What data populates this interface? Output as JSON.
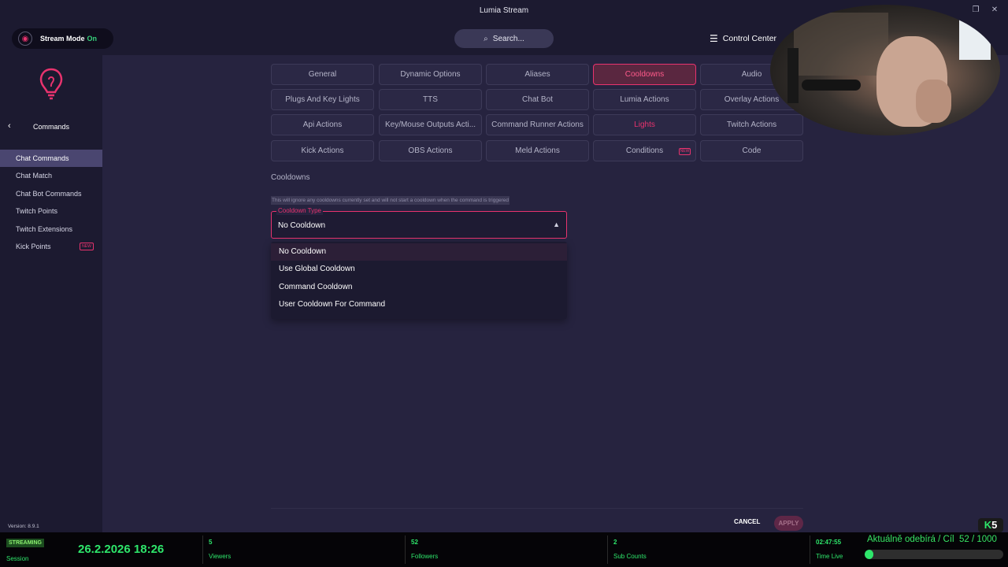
{
  "window": {
    "title": "Lumia Stream"
  },
  "header": {
    "stream_mode_label": "Stream Mode",
    "stream_mode_state": "On",
    "search_placeholder": "Search...",
    "control_center_label": "Control Center"
  },
  "sidebar": {
    "section_title": "Commands",
    "items": [
      {
        "label": "Chat Commands"
      },
      {
        "label": "Chat Match"
      },
      {
        "label": "Chat Bot Commands"
      },
      {
        "label": "Twitch Points"
      },
      {
        "label": "Twitch Extensions"
      },
      {
        "label": "Kick Points",
        "badge": "NEW"
      }
    ],
    "version": "Version: 8.9.1"
  },
  "tabs": {
    "row1": [
      "General",
      "Dynamic Options",
      "Aliases",
      "Cooldowns",
      "Audio"
    ],
    "row2": [
      "Plugs And Key Lights",
      "TTS",
      "Chat Bot",
      "Lumia Actions",
      "Overlay Actions"
    ],
    "row3": [
      "Api Actions",
      "Key/Mouse Outputs Acti...",
      "Command Runner Actions",
      "Lights",
      "Twitch Actions"
    ],
    "row4": [
      "Kick Actions",
      "OBS Actions",
      "Meld Actions",
      "Conditions",
      "Code"
    ],
    "conditions_badge": "NEW",
    "active": "Cooldowns"
  },
  "cooldowns": {
    "heading": "Cooldowns",
    "hint": "This will ignore any cooldowns currently set and will not start a cooldown when the command is triggered",
    "select_label": "Cooldown Type",
    "select_value": "No Cooldown",
    "options": [
      "No Cooldown",
      "Use Global Cooldown",
      "Command Cooldown",
      "User Cooldown For Command"
    ]
  },
  "actions": {
    "cancel": "CANCEL",
    "apply": "APPLY"
  },
  "statusbar": {
    "streaming": "STREAMING",
    "session_label": "Session",
    "datetime": "26.2.2026 18:26",
    "viewers_value": "5",
    "viewers_label": "Viewers",
    "followers_value": "52",
    "followers_label": "Followers",
    "subs_value": "2",
    "subs_label": "Sub Counts",
    "time_live_value": "02:47:55",
    "time_live_label": "Time Live",
    "goal_text": "Aktuálně odebírá / Cíl",
    "goal_value": "52 / 1000",
    "goal_fraction": 0.052,
    "goal_logo_k": "K",
    "goal_logo_num": "5"
  },
  "colors": {
    "accent": "#e8336e",
    "bg": "#26233f",
    "panel": "#1c1a30",
    "status_green": "#2ee66b"
  }
}
